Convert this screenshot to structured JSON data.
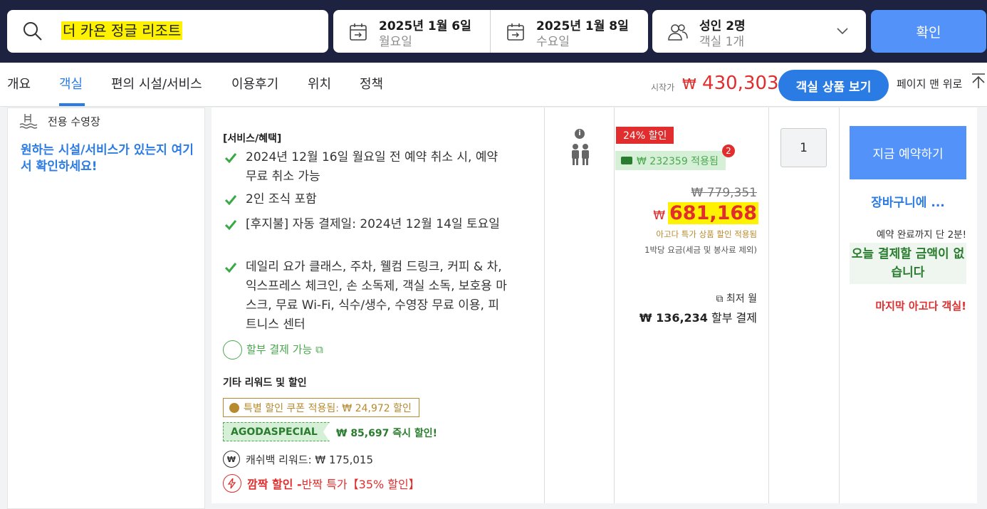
{
  "search": {
    "query": "더 카욘 정글 리조트"
  },
  "dates": {
    "checkin": {
      "date": "2025년 1월 6일",
      "weekday": "월요일"
    },
    "checkout": {
      "date": "2025년 1월 8일",
      "weekday": "수요일"
    }
  },
  "guests": {
    "summary": "성인 2명",
    "rooms": "객실 1개"
  },
  "confirm_label": "확인",
  "tabs": [
    {
      "label": "개요"
    },
    {
      "label": "객실"
    },
    {
      "label": "편의 시설/서비스"
    },
    {
      "label": "이용후기"
    },
    {
      "label": "위치"
    },
    {
      "label": "정책"
    }
  ],
  "tab_active": "객실",
  "starting": {
    "label": "시작가",
    "currency": "₩",
    "price": "430,303"
  },
  "view_rooms_label": "객실 상품 보기",
  "to_top_label": "페이지 맨 위로",
  "left": {
    "pool_label": "전용 수영장",
    "find_link": "원하는 시설/서비스가 있는지 여기서 확인하세요!"
  },
  "room": {
    "benefits_title": "[서비스/혜택]",
    "benefits": [
      "2024년 12월 16일 월요일 전 예약 취소 시, 예약 무료 취소 가능",
      "2인 조식 포함",
      "[후지불] 자동 결제일: 2024년 12월 14일 토요일",
      "데일리 요가 클래스, 주차, 웰컴 드링크, 커피 & 차, 익스프레스 체크인, 손 소독제, 객실 소독, 보호용 마스크, 무료 Wi-Fi, 식수/생수, 수영장 무료 이용, 피트니스 센터"
    ],
    "installment_label": "할부 결제 가능",
    "other_title": "기타 리워드 및 할인",
    "coupon_text": "특별 할인 쿠폰 적용됨: ₩ 24,972 할인",
    "agoda_code": "AGODASPECIAL",
    "agoda_discount": "₩ 85,697 즉시 할인!",
    "cashback_text": "캐쉬백 리워드: ₩ 175,015",
    "flash_bold": "깜짝 할인 -",
    "flash_text": " 반짝 특가【35% 할인】",
    "discount_badge": "24% 할인",
    "coupon_applied": "₩ 232359 적용됨",
    "coupon_count": "2",
    "original_price": "₩ 779,351",
    "final_currency": "₩",
    "final_price": "681,168",
    "agoda_special_note": "아고다 특가 상품 할인 적용됨",
    "per_night_note": "1박당 요금(세금 및 봉사료 제외)",
    "lowest_month": "최저 월",
    "monthly_amount": "₩ 136,234",
    "monthly_suffix": " 할부 결제",
    "quantity": "1",
    "book_now": "지금 예약하기",
    "cart_link": "장바구니에 ...",
    "until_done": "예약 완료까지 단 2분!",
    "pay_today": "오늘 결제할 금액이 없습니다",
    "last_room": "마지막 아고다 객실!"
  },
  "colors": {
    "nav_bg": "#1d2241",
    "primary_blue": "#2b7be4",
    "button_blue": "#5392f9",
    "price_red": "#e12d2d",
    "highlight_yellow": "#fff200",
    "green": "#4aa84d"
  },
  "icons": [
    "search-icon",
    "calendar-icon",
    "people-icon",
    "chevron-down-icon",
    "arrow-up-icon",
    "pool-icon",
    "check-icon",
    "info-icon",
    "person-pair-icon",
    "ticket-icon",
    "external-link-icon",
    "cashback-icon",
    "lightning-icon"
  ]
}
